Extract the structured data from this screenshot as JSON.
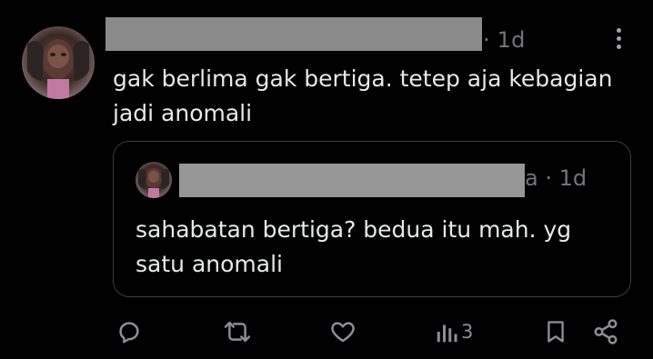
{
  "tweet": {
    "time": "· 1d",
    "text": "gak berlima gak bertiga. tetep aja kebagian jadi anomali"
  },
  "quoted_tweet": {
    "time": "a · 1d",
    "text": "sahabatan bertiga? bedua itu mah. yg satu anomali"
  },
  "actions": {
    "views_count": "3"
  },
  "colors": {
    "background": "#000000",
    "text": "#e7e9ea",
    "secondary": "#71767b",
    "redaction": "#8a8a8a"
  }
}
